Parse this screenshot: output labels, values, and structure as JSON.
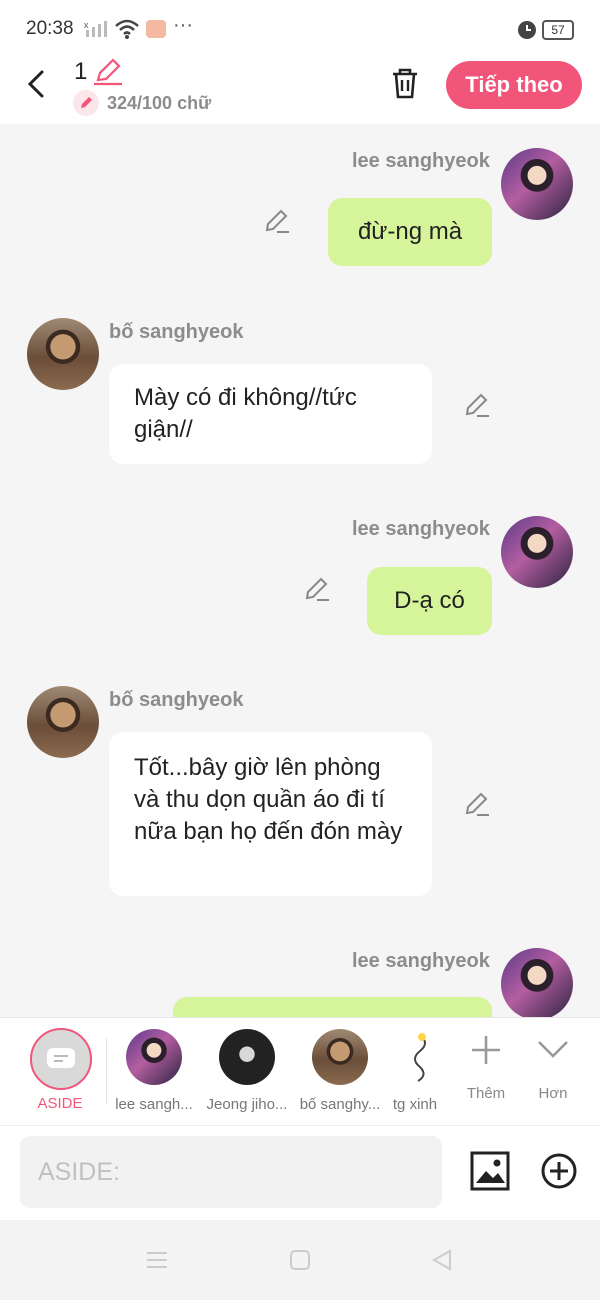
{
  "status": {
    "time": "20:38",
    "battery": "57",
    "icons": [
      "signal-muted-icon",
      "wifi-icon",
      "app-notification-icon",
      "more-dots-icon",
      "alarm-icon",
      "battery-icon"
    ]
  },
  "header": {
    "episode_number": "1",
    "word_count": "324/100 chữ",
    "next_label": "Tiếp theo",
    "accent": "#f2557a"
  },
  "messages": [
    {
      "side": "right",
      "name": "lee sanghyeok",
      "text": "đừ-ng mà"
    },
    {
      "side": "left",
      "name": "bố sanghyeok",
      "text": "Mày có đi không//tức giận//"
    },
    {
      "side": "right",
      "name": "lee sanghyeok",
      "text": "D-ạ có"
    },
    {
      "side": "left",
      "name": "bố sanghyeok",
      "text": "Tốt...bây giờ lên phòng và thu dọn quần áo đi tí nữa bạn họ đến đón mày"
    },
    {
      "side": "right",
      "name": "lee sanghyeok",
      "text": ""
    }
  ],
  "characters": {
    "aside_label": "ASIDE",
    "items": [
      {
        "label": "lee sangh..."
      },
      {
        "label": "Jeong jiho..."
      },
      {
        "label": "bố sanghy..."
      },
      {
        "label": "tg xinh"
      }
    ],
    "add_label": "Thêm",
    "more_label": "Hơn"
  },
  "composer": {
    "placeholder": "ASIDE:"
  },
  "colors": {
    "bubble_right": "#d6f59a",
    "bubble_left": "#ffffff",
    "accent": "#f2557a"
  }
}
